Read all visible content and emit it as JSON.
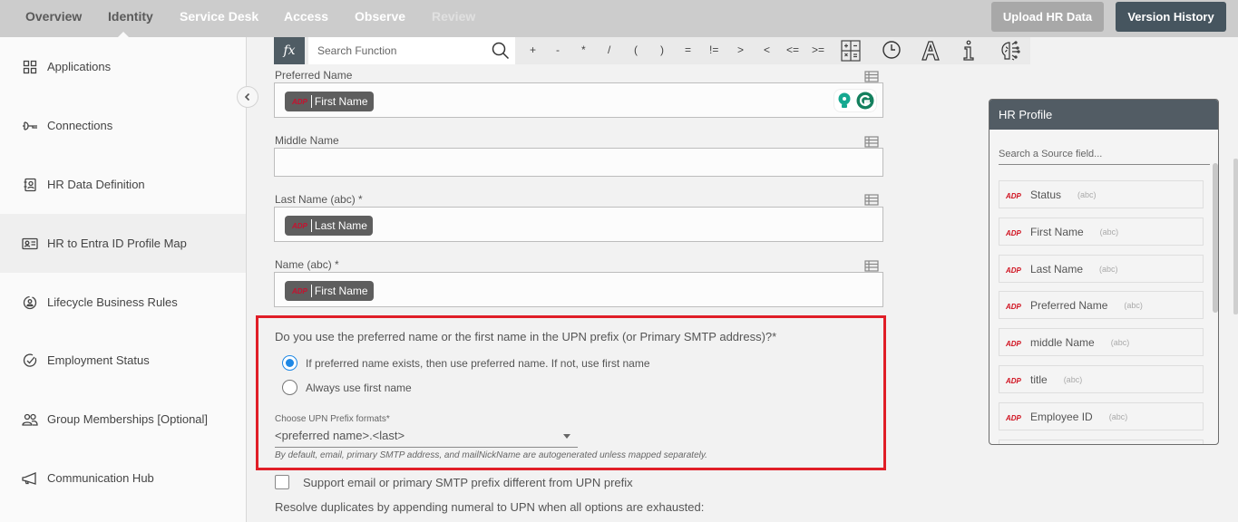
{
  "topnav": {
    "tabs": [
      {
        "label": "Overview",
        "state": "normal"
      },
      {
        "label": "Identity",
        "state": "active"
      },
      {
        "label": "Service Desk",
        "state": "normal"
      },
      {
        "label": "Access",
        "state": "normal"
      },
      {
        "label": "Observe",
        "state": "normal"
      },
      {
        "label": "Review",
        "state": "disabled"
      }
    ],
    "upload_label": "Upload HR Data",
    "version_label": "Version History"
  },
  "sidebar": {
    "items": [
      {
        "label": "Applications",
        "icon": "grid-icon"
      },
      {
        "label": "Connections",
        "icon": "plug-icon"
      },
      {
        "label": "HR Data Definition",
        "icon": "contact-book-icon"
      },
      {
        "label": "HR to Entra ID Profile Map",
        "icon": "id-card-icon",
        "active": true
      },
      {
        "label": "Lifecycle Business Rules",
        "icon": "user-circle-icon"
      },
      {
        "label": "Employment Status",
        "icon": "check-circle-icon"
      },
      {
        "label": "Group Memberships [Optional]",
        "icon": "users-icon"
      },
      {
        "label": "Communication Hub",
        "icon": "megaphone-icon"
      }
    ]
  },
  "toolbar": {
    "fx_label": "fx",
    "search_placeholder": "Search Function",
    "operators": [
      "+",
      "-",
      "*",
      "/",
      "(",
      ")",
      "=",
      "!=",
      ">",
      "<",
      "<=",
      ">="
    ]
  },
  "fields": [
    {
      "label": "Preferred Name",
      "chip": "First Name",
      "chip_source": "ADP"
    },
    {
      "label": "Middle Name",
      "chip": null
    },
    {
      "label": "Last Name (abc) *",
      "chip": "Last Name",
      "chip_source": "ADP"
    },
    {
      "label": "Name (abc) *",
      "chip": "First Name",
      "chip_source": "ADP"
    }
  ],
  "upn": {
    "question": "Do you use the preferred name or the first name in the UPN prefix (or Primary SMTP address)?*",
    "options": [
      {
        "label": "If preferred name exists, then use preferred name. If not, use first name",
        "checked": true
      },
      {
        "label": "Always use first name",
        "checked": false
      }
    ],
    "format_label": "Choose UPN Prefix formats*",
    "format_value": "<preferred name>.<last>",
    "hint": "By default, email, primary SMTP address, and mailNickName are autogenerated unless mapped separately.",
    "support_email_label": "Support email or primary SMTP prefix different from UPN prefix",
    "support_email_checked": false,
    "resolve_label": "Resolve duplicates by appending numeral to UPN when all options are exhausted:"
  },
  "hr_profile": {
    "title": "HR Profile",
    "search_placeholder": "Search a Source field...",
    "source_badge": "ADP",
    "items": [
      {
        "name": "Status",
        "type": "(abc)"
      },
      {
        "name": "First Name",
        "type": "(abc)"
      },
      {
        "name": "Last Name",
        "type": "(abc)"
      },
      {
        "name": "Preferred Name",
        "type": "(abc)"
      },
      {
        "name": "middle Name",
        "type": "(abc)"
      },
      {
        "name": "title",
        "type": "(abc)"
      },
      {
        "name": "Employee ID",
        "type": "(abc)"
      }
    ]
  },
  "colors": {
    "highlight": "#e01e27",
    "accent": "#1e88e5",
    "header_dark": "#46555f",
    "adp_red": "#c8102e"
  }
}
